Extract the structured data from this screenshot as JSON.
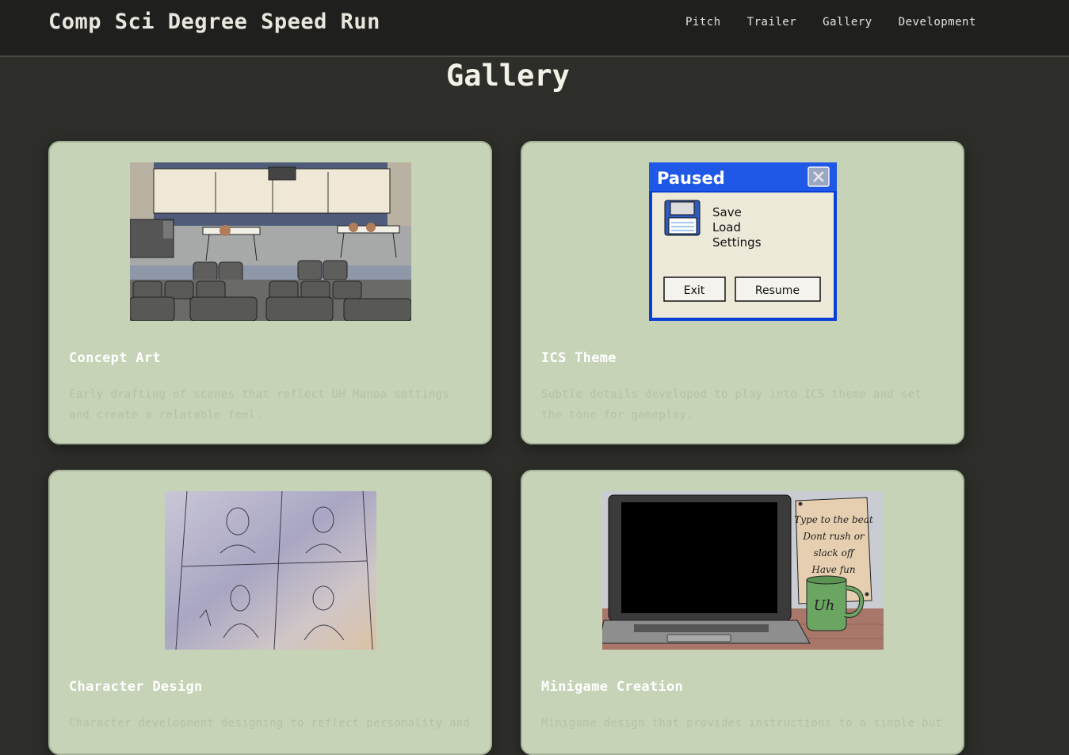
{
  "site": {
    "title": "Comp Sci Degree Speed Run"
  },
  "nav": {
    "items": [
      {
        "label": "Pitch"
      },
      {
        "label": "Trailer"
      },
      {
        "label": "Gallery"
      },
      {
        "label": "Development"
      }
    ]
  },
  "page": {
    "heading": "Gallery"
  },
  "cards": [
    {
      "title": "Concept Art",
      "description": "Early drafting of scenes that reflect UH Manoa settings and create a relatable feel."
    },
    {
      "title": "ICS Theme",
      "description": "Subtle details developed to play into ICS theme and set the tone for gameplay.",
      "dialog": {
        "title": "Paused",
        "menu": [
          "Save",
          "Load",
          "Settings"
        ],
        "exit_label": "Exit",
        "resume_label": "Resume"
      }
    },
    {
      "title": "Character Design",
      "description": "Character development designing to reflect personality and"
    },
    {
      "title": "Minigame Creation",
      "description": "Minigame design that provides instructions to a simple but",
      "note": {
        "line1": "Type to the beat",
        "line2": "Dont rush or",
        "line3": "slack off",
        "line4": "Have fun"
      },
      "mug_text": "Uh"
    }
  ]
}
